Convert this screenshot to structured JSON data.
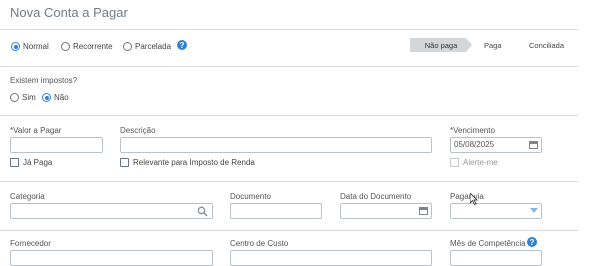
{
  "page": {
    "title": "Nova Conta a Pagar"
  },
  "tipo": {
    "options": [
      {
        "label": "Normal",
        "selected": true
      },
      {
        "label": "Recorrente",
        "selected": false
      },
      {
        "label": "Parcelada",
        "selected": false
      }
    ],
    "help": "?"
  },
  "status": {
    "steps": [
      "Não paga",
      "Paga",
      "Conciliada"
    ],
    "active": "Não paga"
  },
  "impostos": {
    "label": "Existem impostos?",
    "options": [
      {
        "label": "Sim",
        "selected": false
      },
      {
        "label": "Não",
        "selected": true
      }
    ]
  },
  "valor": {
    "label": "*Valor a Pagar",
    "value": ""
  },
  "descricao": {
    "label": "Descrição",
    "value": ""
  },
  "vencimento": {
    "label": "*Vencimento",
    "value": "05/08/2025"
  },
  "ja_paga": {
    "label": "Já Paga",
    "checked": false
  },
  "relevante": {
    "label": "Relevante para Imposto de Renda",
    "checked": false
  },
  "alerte": {
    "label": "Alerte-me",
    "checked": false,
    "disabled": true
  },
  "categoria": {
    "label": "Categoria",
    "value": ""
  },
  "documento": {
    "label": "Documento",
    "value": ""
  },
  "data_documento": {
    "label": "Data do Documento",
    "value": ""
  },
  "pagar_via": {
    "label": "Pagar via",
    "value": ""
  },
  "fornecedor": {
    "label": "Fornecedor"
  },
  "centro_custo": {
    "label": "Centro de Custo"
  },
  "mes_competencia": {
    "label": "Mês de Competência",
    "help": "?"
  },
  "colors": {
    "accent": "#2f80d1",
    "title": "#6f7c87",
    "divider": "#d7dade"
  }
}
